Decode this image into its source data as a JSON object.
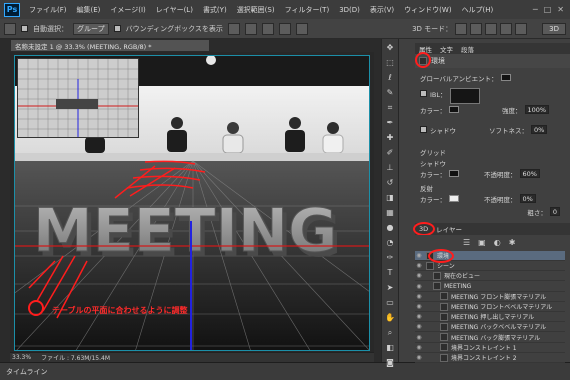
{
  "app": {
    "logo": "Ps",
    "menu": [
      "ファイル(F)",
      "編集(E)",
      "イメージ(I)",
      "レイヤー(L)",
      "書式(Y)",
      "選択範囲(S)",
      "フィルター(T)",
      "3D(D)",
      "表示(V)",
      "ウィンドウ(W)",
      "ヘルプ(H)"
    ],
    "window_controls": [
      "─",
      "□",
      "✕"
    ]
  },
  "options": {
    "auto_select_label": "自動選択：",
    "auto_select_value": "グループ",
    "bbox_label": "バウンディングボックスを表示",
    "mode_3d_label": "3D モード：",
    "mode_3d_value": "3D"
  },
  "document": {
    "tab_title": "名称未設定 1 @ 33.3% (MEETING, RGB/8) *",
    "zoom": "33.3%",
    "file_info": "ファイル : 7.63M/15.4M",
    "timeline_label": "タイムライン",
    "canvas_text": "MEETING",
    "annotation": "テーブルの平面に合わせるように調整"
  },
  "properties": {
    "tabs": [
      "属性",
      "文字",
      "段落"
    ],
    "title": "環境",
    "global_ambient_label": "グローバルアンビエント：",
    "ibl_label": "IBL：",
    "color_label": "カラー：",
    "intensity_label": "強度：",
    "intensity_value": "100%",
    "shadow_label": "シャドウ",
    "softness_label": "ソフトネス：",
    "softness_value": "0%",
    "ground_label": "グリッド",
    "ground_shadow_label": "シャドウ",
    "ground_color_label": "カラー：",
    "opacity_label": "不透明度：",
    "ground_opacity_value": "60%",
    "reflection_label": "反射",
    "reflection_color_label": "カラー：",
    "reflection_opacity_label": "不透明度：",
    "reflection_opacity_value": "0%",
    "roughness_label": "粗さ：",
    "roughness_value": "0"
  },
  "layers3d": {
    "tabs": [
      "3D",
      "レイヤー"
    ],
    "items": [
      {
        "label": "環境",
        "indent": 0,
        "selected": true
      },
      {
        "label": "シーン",
        "indent": 0,
        "selected": false
      },
      {
        "label": "現在のビュー",
        "indent": 1,
        "selected": false
      },
      {
        "label": "MEETING",
        "indent": 1,
        "selected": false
      },
      {
        "label": "MEETING フロント膨張マテリアル",
        "indent": 2,
        "selected": false
      },
      {
        "label": "MEETING フロントベベルマテリアル",
        "indent": 2,
        "selected": false
      },
      {
        "label": "MEETING 押し出しマテリアル",
        "indent": 2,
        "selected": false
      },
      {
        "label": "MEETING バックベベルマテリアル",
        "indent": 2,
        "selected": false
      },
      {
        "label": "MEETING バック膨張マテリアル",
        "indent": 2,
        "selected": false
      },
      {
        "label": "境界コンストレイント 1",
        "indent": 2,
        "selected": false
      },
      {
        "label": "境界コンストレイント 2",
        "indent": 2,
        "selected": false
      }
    ]
  },
  "colors": {
    "accent": "#31a8ff",
    "annotation_red": "#ff1d1d",
    "canvas_border": "#1c8fa8"
  }
}
